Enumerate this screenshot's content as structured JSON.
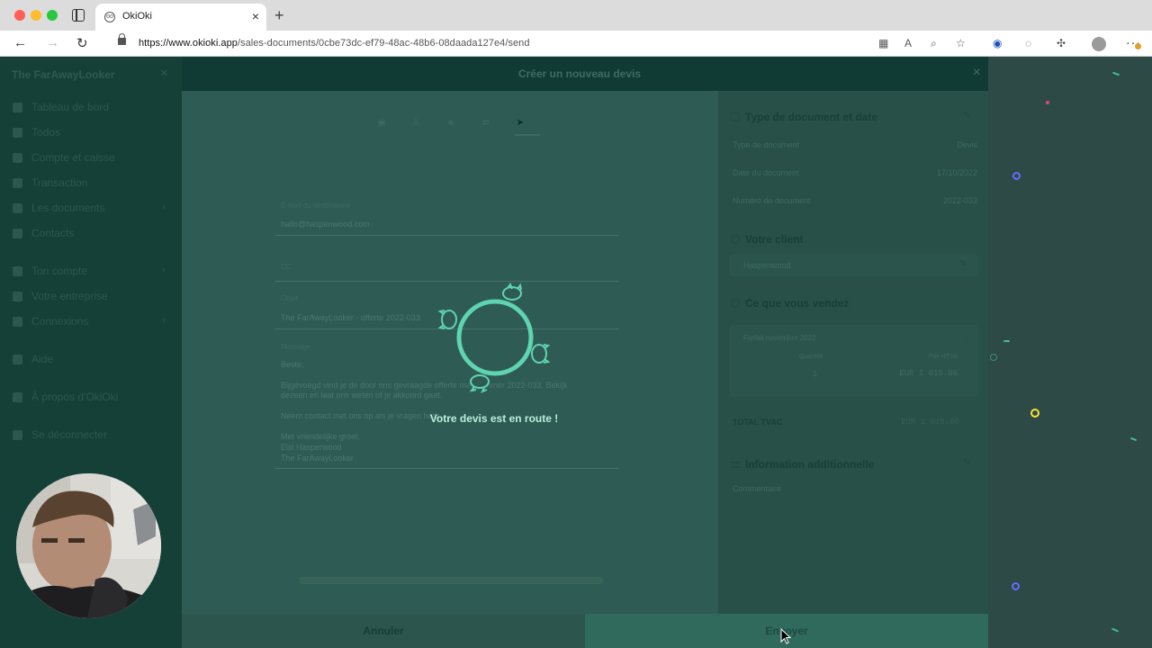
{
  "browser": {
    "tab_title": "OkiOki",
    "favicon_letter": "oo",
    "url_origin": "https://www.okioki.app",
    "url_path": "/sales-documents/0cbe73dc-ef79-48ac-48b6-08daada127e4/send"
  },
  "sidebar": {
    "title": "The FarAwayLooker",
    "items": [
      {
        "label": "Tableau de bord"
      },
      {
        "label": "Todos"
      },
      {
        "label": "Compte et caisse"
      },
      {
        "label": "Transaction"
      },
      {
        "label": "Les documents"
      },
      {
        "label": "Contacts"
      },
      {
        "label": "Ton compte"
      },
      {
        "label": "Votre entreprise"
      },
      {
        "label": "Connexions"
      },
      {
        "label": "Aide"
      },
      {
        "label": "À propos d'OkiOki"
      },
      {
        "label": "Se déconnecter"
      }
    ]
  },
  "modal": {
    "title": "Créer un nouveau devis",
    "form": {
      "email_label": "E-mail du destinataire",
      "email_value": "hallo@haspenwood.com",
      "cc_label": "CC",
      "subject_label": "Objet",
      "subject_value": "The FarAwayLooker - offerte 2022-033",
      "message_label": "Message",
      "message_lines": [
        "Beste,",
        "Bijgevoegd vind je de door ons gevraagde offerte met nummer 2022-033. Bekijk",
        "dezeen en laat ons weten of je akkoord gaat.",
        "Neem contact met ons op als je vragen hebt.",
        "Met vriendelijke groet,",
        "Elsi Hasperwood",
        "The FarAwayLooker"
      ]
    },
    "cancel_label": "Annuler",
    "send_label": "Envoyer"
  },
  "summary": {
    "doc_section_title": "Type de document et date",
    "doc_rows": [
      {
        "label": "Type de document",
        "value": "Devis"
      },
      {
        "label": "Date du document",
        "value": "17/10/2022"
      },
      {
        "label": "Numéro de document",
        "value": "2022-033"
      }
    ],
    "client_section_title": "Votre client",
    "client_name": "Haspenwood",
    "sell_section_title": "Ce que vous vendez",
    "product_name": "Forfait novembre 2022",
    "qty_header": "Quantité",
    "price_header": "Prix HTVA",
    "product_qty": "1",
    "product_price": "EUR 1 015.00",
    "total_label": "TOTAL TVAC",
    "total_value": "EUR 1 015.00",
    "additional_section_title": "Information additionnelle",
    "comment_label": "Commentaire"
  },
  "loader": {
    "message": "Votre devis est en route !"
  },
  "colors": {
    "accent": "#5fd4b0",
    "modal_header": "#0f3b34",
    "sidebar": "#154037"
  }
}
